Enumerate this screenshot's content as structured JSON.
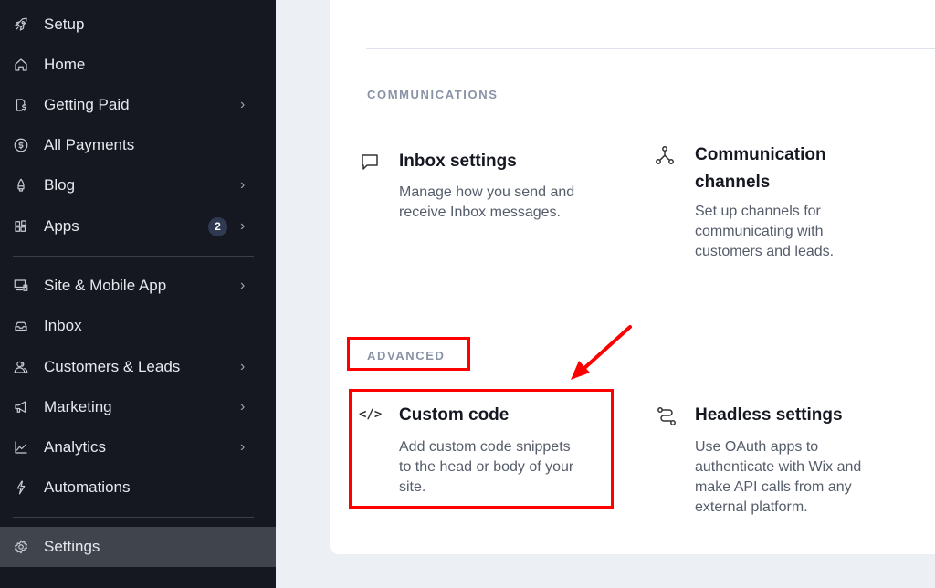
{
  "sidebar": {
    "items": [
      {
        "label": "Setup",
        "icon": "rocket-icon",
        "chevron": false
      },
      {
        "label": "Home",
        "icon": "home-icon",
        "chevron": false
      },
      {
        "label": "Getting Paid",
        "icon": "invoice-dollar-icon",
        "chevron": true
      },
      {
        "label": "All Payments",
        "icon": "dollar-circle-icon",
        "chevron": true
      },
      {
        "label": "Blog",
        "icon": "pen-nib-icon",
        "chevron": true
      },
      {
        "label": "Apps",
        "icon": "apps-grid-icon",
        "chevron": true,
        "badge": "2"
      },
      {
        "label": "Site & Mobile App",
        "icon": "devices-icon",
        "chevron": true
      },
      {
        "label": "Inbox",
        "icon": "inbox-icon",
        "chevron": false
      },
      {
        "label": "Customers & Leads",
        "icon": "people-icon",
        "chevron": true
      },
      {
        "label": "Marketing",
        "icon": "megaphone-icon",
        "chevron": true
      },
      {
        "label": "Analytics",
        "icon": "chart-line-icon",
        "chevron": true
      },
      {
        "label": "Automations",
        "icon": "lightning-icon",
        "chevron": false
      },
      {
        "label": "Settings",
        "icon": "gear-icon",
        "chevron": false,
        "active": true
      }
    ],
    "chevron_glyph": "›"
  },
  "main": {
    "sections": [
      {
        "title": "COMMUNICATIONS",
        "items": [
          {
            "title": "Inbox settings",
            "description": [
              "Manage how you send and",
              "receive Inbox messages."
            ],
            "icon": "chat-bubble-icon"
          },
          {
            "title_lines": [
              "Communication",
              "channels"
            ],
            "description": [
              "Set up channels for",
              "communicating with",
              "customers and leads."
            ],
            "icon": "network-nodes-icon"
          }
        ]
      },
      {
        "title": "ADVANCED",
        "items": [
          {
            "title": "Custom code",
            "description": [
              "Add custom code snippets",
              "to the head or body of your",
              "site."
            ],
            "icon": "code-icon",
            "icon_glyph": "</>"
          },
          {
            "title": "Headless settings",
            "description": [
              "Use OAuth apps to",
              "authenticate with Wix and",
              "make API calls from any",
              "external platform."
            ],
            "icon": "route-icon"
          }
        ]
      }
    ]
  },
  "annotations": {
    "highlight_color": "#ff0000"
  }
}
